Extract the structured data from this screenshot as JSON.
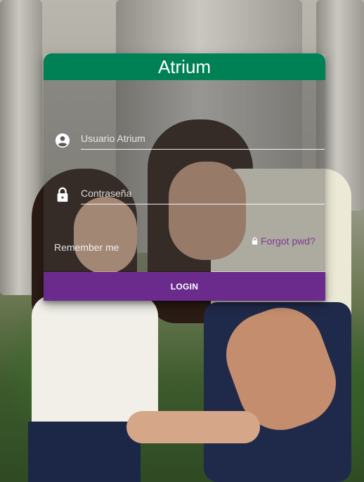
{
  "app": {
    "title": "Atrium"
  },
  "login_form": {
    "username_placeholder": "Usuario Atrium",
    "username_value": "",
    "password_placeholder": "Contraseña",
    "password_value": "",
    "remember_label": "Remember me",
    "forgot_label": "Forgot pwd?",
    "login_label": "LOGIN"
  },
  "icons": {
    "username": "account-circle-icon",
    "password": "lock-icon",
    "forgot": "lock-icon"
  },
  "colors": {
    "header": "#008155",
    "login_button": "#6a2b8c",
    "forgot_link": "#7b3a94"
  }
}
